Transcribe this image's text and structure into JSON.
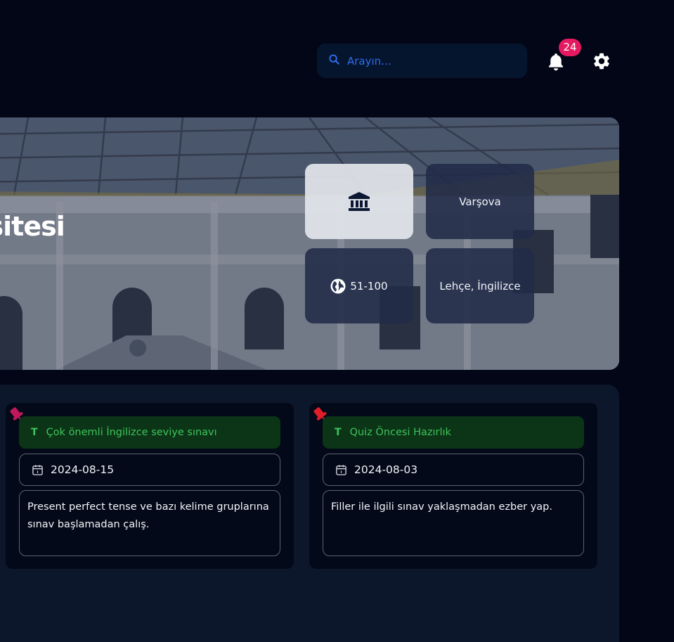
{
  "header": {
    "search_placeholder": "Arayın...",
    "notification_count": "24"
  },
  "hero": {
    "title_visible": "ersitesi",
    "cards": {
      "type_icon": "institution-icon",
      "city": "Varşova",
      "ranking": "51-100",
      "languages": "Lehçe, İngilizce"
    }
  },
  "notes": [
    {
      "title": "Çok önemli İngilizce seviye sınavı",
      "date": "2024-08-15",
      "body": "Present perfect tense ve bazı kelime gruplarına sınav başlamadan çalış.",
      "pin_color": "#c2185b"
    },
    {
      "title": "Quiz Öncesi Hazırlık",
      "date": "2024-08-03",
      "body": "Filler ile ilgili sınav yaklaşmadan ezber yap.",
      "pin_color": "#e01e2a"
    }
  ],
  "colors": {
    "background": "#020617",
    "accent_blue": "#2f6ef0",
    "badge": "#e5195f",
    "note_title_text": "#3ec45c",
    "note_title_bg": "#0b3516"
  }
}
